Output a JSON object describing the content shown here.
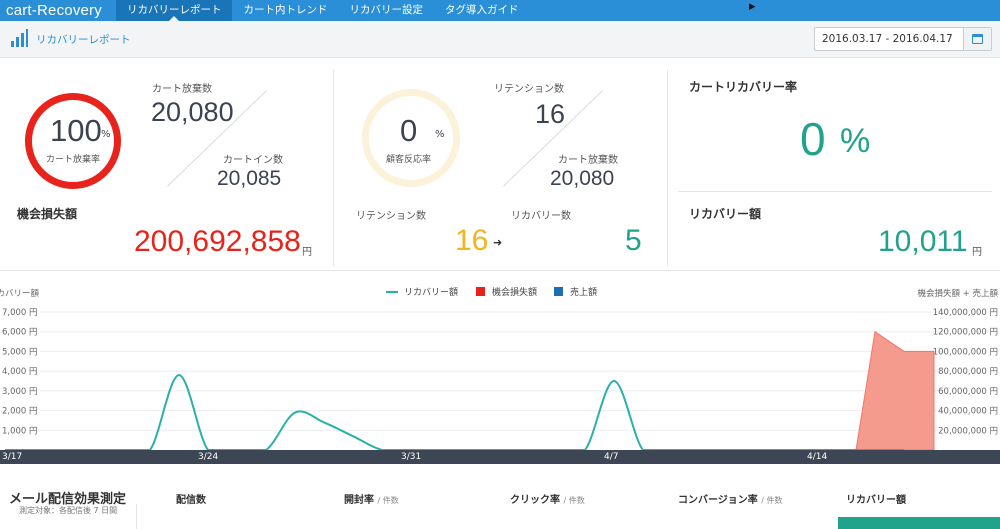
{
  "nav": {
    "brand": "cart-Recovery",
    "items": [
      "リカバリーレポート",
      "カート内トレンド",
      "リカバリー設定",
      "タグ導入ガイド"
    ],
    "cursor": "➤"
  },
  "subheader": {
    "title": "リカバリーレポート",
    "date_range": "2016.03.17 - 2016.04.17"
  },
  "panel1": {
    "rate_value": "100",
    "rate_unit": "%",
    "rate_label": "カート放棄率",
    "abandon_label": "カート放棄数",
    "abandon_value": "20,080",
    "cartin_label": "カートイン数",
    "cartin_value": "20,085",
    "loss_label": "機会損失額",
    "loss_value": "200,692,858",
    "loss_unit": "円"
  },
  "panel2": {
    "rate_value": "0",
    "rate_unit": "%",
    "rate_label": "顧客反応率",
    "retention_label": "リテンション数",
    "retention_value": "16",
    "abandon_label": "カート放棄数",
    "abandon_value": "20,080",
    "bottom_retention_label": "リテンション数",
    "bottom_retention_value": "16",
    "arrow": "➜",
    "recovery_label": "リカバリー数",
    "recovery_value": "5"
  },
  "panel3": {
    "rate_label": "カートリカバリー率",
    "rate_value": "0",
    "rate_unit": "%",
    "amount_label": "リカバリー額",
    "amount_value": "10,011",
    "amount_unit": "円"
  },
  "colors": {
    "nav_blue": "#2a8fd6",
    "red": "#e8231c",
    "orange": "#f6b21f",
    "teal": "#21a28c",
    "axis_dark": "#3d4654"
  },
  "chart_data": {
    "type": "area",
    "left_axis_title": "リカバリー額",
    "right_axis_title": "機会損失額 + 売上額",
    "legend": [
      {
        "name": "リカバリー額",
        "color": "#2ab0a8",
        "kind": "line"
      },
      {
        "name": "機会損失額",
        "color": "#e8231c",
        "kind": "box"
      },
      {
        "name": "売上額",
        "color": "#1f6fb0",
        "kind": "box"
      }
    ],
    "left_ticks": [
      "1,000 円",
      "2,000 円",
      "3,000 円",
      "4,000 円",
      "5,000 円",
      "6,000 円",
      "7,000 円"
    ],
    "right_ticks": [
      "20,000,000 円",
      "40,000,000 円",
      "60,000,000 円",
      "80,000,000 円",
      "100,000,000 円",
      "120,000,000 円",
      "140,000,000 円"
    ],
    "ylim_left": [
      0,
      7000
    ],
    "ylim_right": [
      0,
      140000000
    ],
    "x_dates": [
      "3/17",
      "3/18",
      "3/19",
      "3/20",
      "3/21",
      "3/22",
      "3/23",
      "3/24",
      "3/25",
      "3/26",
      "3/27",
      "3/28",
      "3/29",
      "3/30",
      "3/31",
      "4/1",
      "4/2",
      "4/3",
      "4/4",
      "4/5",
      "4/6",
      "4/7",
      "4/8",
      "4/9",
      "4/10",
      "4/11",
      "4/12",
      "4/13",
      "4/14",
      "4/15",
      "4/16",
      "4/17"
    ],
    "x_tick_labels": [
      "3/17",
      "3/24",
      "3/31",
      "4/7",
      "4/14"
    ],
    "recovery_series": [
      0,
      0,
      0,
      0,
      0,
      0,
      3800,
      0,
      0,
      0,
      1900,
      1400,
      700,
      0,
      0,
      0,
      0,
      0,
      0,
      0,
      0,
      3500,
      0,
      0,
      0,
      0,
      0,
      0,
      0,
      0,
      0,
      0
    ],
    "loss_series": [
      0,
      0,
      0,
      0,
      0,
      0,
      0,
      0,
      0,
      0,
      0,
      0,
      0,
      0,
      0,
      0,
      0,
      0,
      0,
      0,
      0,
      0,
      0,
      0,
      0,
      0,
      0,
      0,
      0,
      0,
      120000000,
      100000000
    ],
    "sales_series": [
      0,
      0,
      0,
      0,
      0,
      0,
      0,
      0,
      0,
      0,
      0,
      0,
      0,
      0,
      0,
      0,
      0,
      0,
      0,
      0,
      0,
      0,
      0,
      0,
      0,
      0,
      0,
      0,
      0,
      0,
      0,
      0
    ]
  },
  "bottom": {
    "title": "メール配信効果測定",
    "subtitle": "測定対象：各配信後 7 日間",
    "cols": [
      {
        "label": "配信数",
        "unit": ""
      },
      {
        "label": "開封率",
        "unit": "/ 件数"
      },
      {
        "label": "クリック率",
        "unit": "/ 件数"
      },
      {
        "label": "コンバージョン率",
        "unit": "/ 件数"
      },
      {
        "label": "リカバリー額",
        "unit": ""
      }
    ]
  }
}
